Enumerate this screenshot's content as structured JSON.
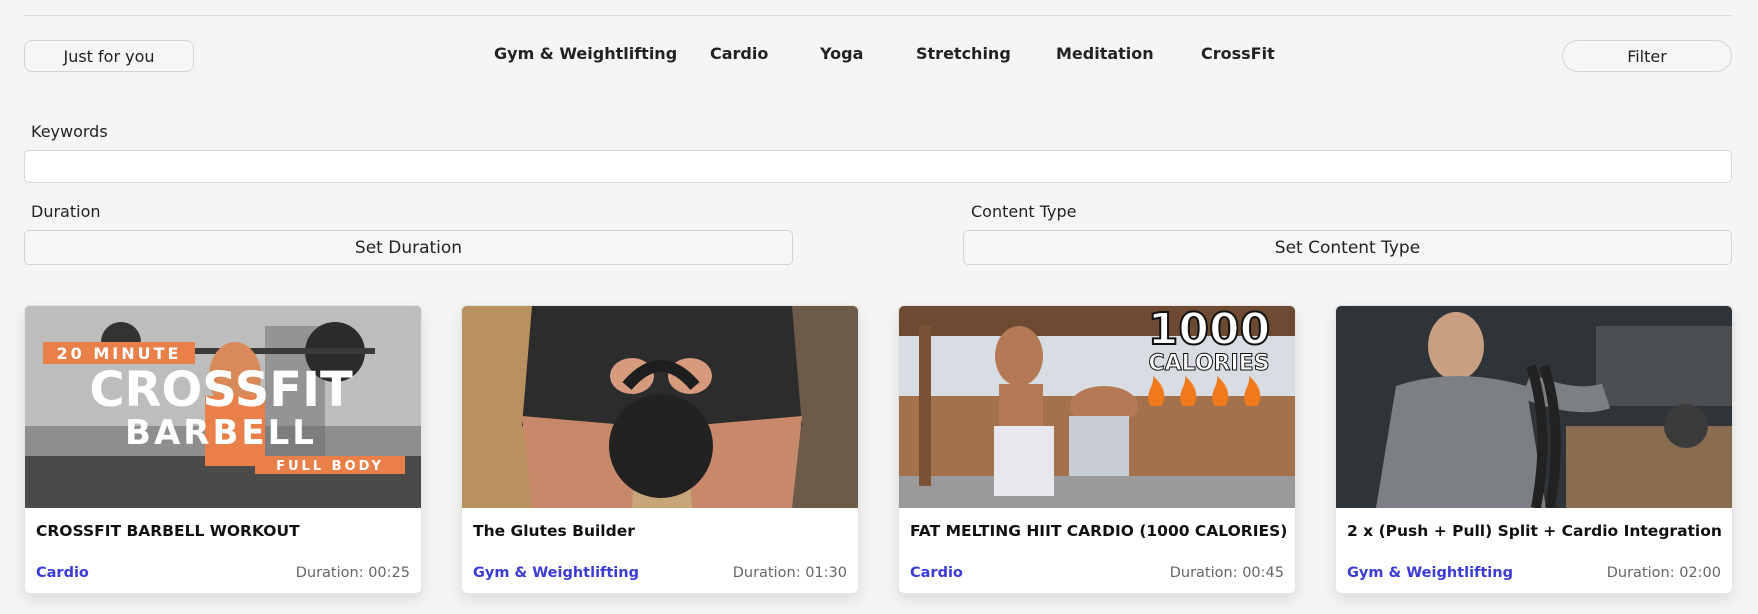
{
  "header": {
    "just_for_you_label": "Just for you",
    "filter_label": "Filter"
  },
  "categories": [
    "Gym & Weightlifting",
    "Cardio",
    "Yoga",
    "Stretching",
    "Meditation",
    "CrossFit"
  ],
  "filters": {
    "keywords_label": "Keywords",
    "keywords_value": "",
    "keywords_placeholder": "",
    "duration_label": "Duration",
    "duration_button": "Set Duration",
    "content_type_label": "Content Type",
    "content_type_button": "Set Content Type"
  },
  "cards": [
    {
      "title": "CROSSFIT BARBELL WORKOUT",
      "category": "Cardio",
      "duration": "Duration: 00:25",
      "thumb_text": [
        "20 MINUTE",
        "CROSSFIT",
        "BARBELL",
        "FULL BODY"
      ]
    },
    {
      "title": "The Glutes Builder",
      "category": "Gym & Weightlifting",
      "duration": "Duration: 01:30",
      "thumb_text": []
    },
    {
      "title": "FAT MELTING HIIT CARDIO (1000 CALORIES)",
      "category": "Cardio",
      "duration": "Duration: 00:45",
      "thumb_text": [
        "1000",
        "CALORIES"
      ]
    },
    {
      "title": "2 x (Push + Pull) Split + Cardio Integration",
      "category": "Gym & Weightlifting",
      "duration": "Duration: 02:00",
      "thumb_text": []
    }
  ],
  "colors": {
    "accent": "#3b3bd6",
    "background": "#f5f5f5",
    "thumb_orange": "#e9804a"
  }
}
